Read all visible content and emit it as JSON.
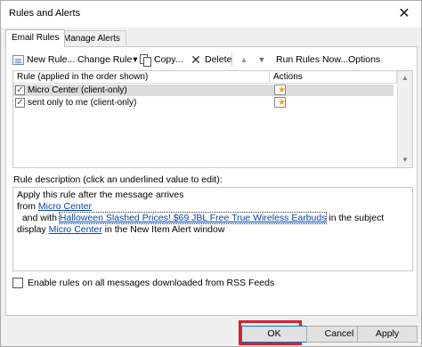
{
  "window": {
    "title": "Rules and Alerts",
    "close_glyph": "✕"
  },
  "tabs": [
    {
      "label": "Email Rules",
      "active": true
    },
    {
      "label": "Manage Alerts",
      "active": false
    }
  ],
  "toolbar": {
    "new_rule": "New Rule...",
    "change_rule": "Change Rule",
    "change_rule_caret": "▾",
    "copy": "Copy...",
    "delete": "Delete",
    "move_up": "▲",
    "move_down": "▼",
    "run_rules_now": "Run Rules Now...",
    "options": "Options"
  },
  "rules_table": {
    "columns": [
      "Rule (applied in the order shown)",
      "Actions"
    ],
    "rows": [
      {
        "name": "Micro Center  (client-only)",
        "checked": true,
        "selected": true
      },
      {
        "name": "sent only to me  (client-only)",
        "checked": true,
        "selected": false
      }
    ],
    "check_glyph": "✓"
  },
  "description": {
    "label": "Rule description (click an underlined value to edit):",
    "line1": "Apply this rule after the message arrives",
    "line2_prefix": "from ",
    "line2_link": "Micro Center",
    "line3_prefix": "  and with ",
    "line3_link": "Halloween Slashed Prices! $69 JBL Free True Wireless Earbuds",
    "line3_suffix": " in the subject",
    "line4_prefix": "display ",
    "line4_link": "Micro Center",
    "line4_suffix": " in the New Item Alert window"
  },
  "rss_option": {
    "label": "Enable rules on all messages downloaded from RSS Feeds",
    "checked": false
  },
  "buttons": {
    "ok": "OK",
    "cancel": "Cancel",
    "apply": "Apply"
  },
  "colors": {
    "highlight": "#d6202c",
    "link": "#0645ad",
    "selected_row": "#dcdcdc"
  }
}
